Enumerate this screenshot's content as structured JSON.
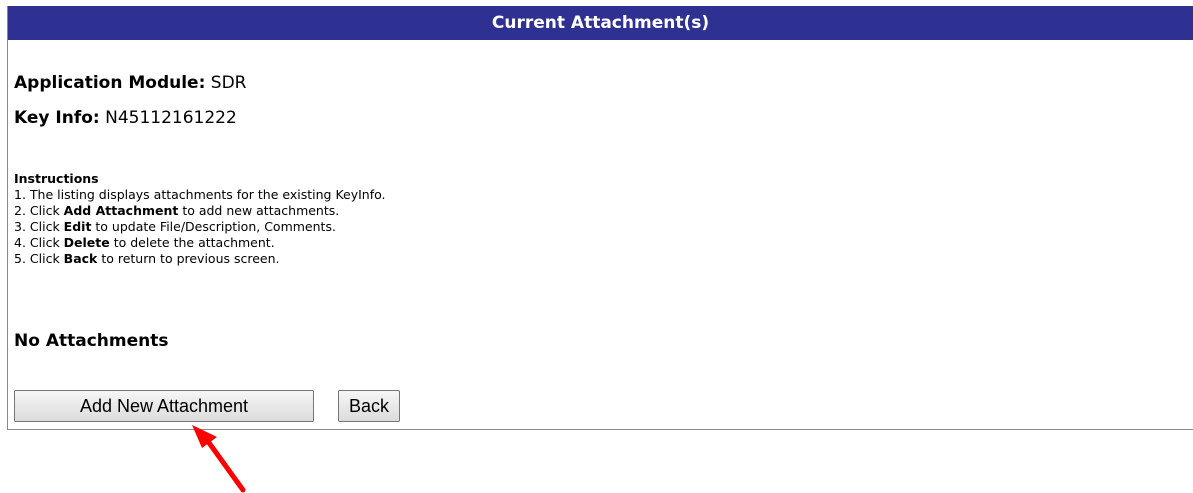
{
  "header": {
    "title": "Current Attachment(s)"
  },
  "info": {
    "module_label": "Application Module:",
    "module_value": "SDR",
    "key_label": "Key Info:",
    "key_value": "N45112161222"
  },
  "instructions": {
    "title": "Instructions",
    "items": [
      {
        "prefix": "1. The listing displays attachments for the existing KeyInfo.",
        "bold": "",
        "suffix": ""
      },
      {
        "prefix": "2. Click ",
        "bold": "Add Attachment",
        "suffix": " to add new attachments."
      },
      {
        "prefix": "3. Click ",
        "bold": "Edit",
        "suffix": " to update File/Description, Comments."
      },
      {
        "prefix": "4. Click ",
        "bold": "Delete",
        "suffix": " to delete the attachment."
      },
      {
        "prefix": "5. Click ",
        "bold": "Back",
        "suffix": " to return to previous screen."
      }
    ]
  },
  "status": {
    "no_attachments": "No Attachments"
  },
  "buttons": {
    "add_new_attachment": "Add New Attachment",
    "back": "Back"
  },
  "annotation": {
    "arrow_color": "#ff0000",
    "header_color": "#2e3192"
  }
}
